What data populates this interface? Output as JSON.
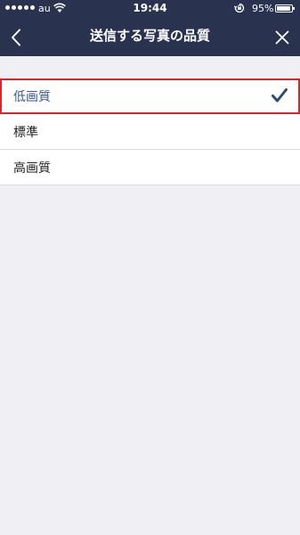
{
  "status_bar": {
    "carrier": "au",
    "time": "19:44",
    "battery_percent_label": "95%",
    "battery_level": 0.95,
    "signal_bars": 5
  },
  "nav": {
    "title": "送信する写真の品質",
    "back_icon": "chevron-left-icon",
    "close_icon": "close-icon"
  },
  "options": [
    {
      "label": "低画質",
      "selected": true
    },
    {
      "label": "標準",
      "selected": false
    },
    {
      "label": "高画質",
      "selected": false
    }
  ],
  "colors": {
    "nav_background": "#293350",
    "page_background": "#efeff4",
    "selected_text": "#3b5a8c",
    "checkmark": "#2e4a7a",
    "highlight_border": "#e0222a"
  }
}
